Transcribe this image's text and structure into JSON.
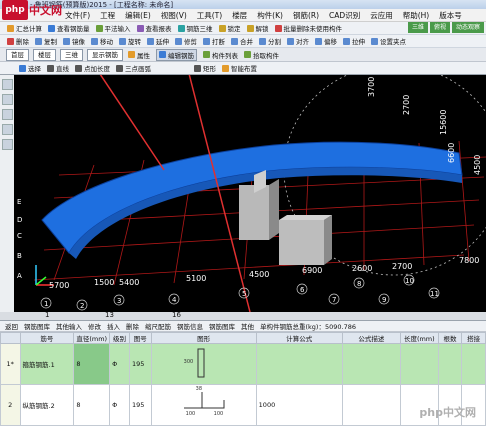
{
  "logo": {
    "badge": "php",
    "text": "中文网"
  },
  "title_bar": {
    "text": "- 鲁班钢筋(预算版)2015 - [工程名称: 未命名]"
  },
  "menu": [
    "文件(F)",
    "工程",
    "编辑(E)",
    "视图(V)",
    "工具(T)",
    "楼层",
    "构件(K)",
    "钢筋(R)",
    "CAD识别",
    "云应用",
    "帮助(H)",
    "版本号"
  ],
  "toolbar1": [
    "汇总计算",
    "查看钢筋量",
    "平法输入",
    "查看报表",
    "钢筋三维",
    "锁定",
    "解锁",
    "批量删除未使用构件",
    "动态观察"
  ],
  "toolbar2": [
    "删除",
    "复制",
    "镜像",
    "移动",
    "旋转",
    "延伸",
    "修剪",
    "打断",
    "合并",
    "分割",
    "对齐",
    "偏移",
    "拉伸",
    "设置夹点"
  ],
  "toolbar3": {
    "floor_select": "首层",
    "category_select": "楼层",
    "item_select": "三维",
    "layer_select": "显示钢筋",
    "buttons": [
      "属性",
      "编辑钢筋",
      "构件列表",
      "拾取构件"
    ]
  },
  "toolbar4": {
    "select_label": "选择",
    "buttons": [
      "直线",
      "点加长度",
      "三点画弧",
      "矩形",
      "智能布置"
    ]
  },
  "right_buttons": [
    "三维",
    "俯视",
    "动态观察"
  ],
  "viewport": {
    "dims_top": [
      "3700",
      "2700",
      "15600",
      "6600",
      "4500"
    ],
    "dims_bottom": [
      "5700",
      "1500",
      "5400",
      "5100",
      "4500",
      "6900",
      "2600",
      "2700",
      "7800"
    ],
    "axis_letters": [
      "E",
      "D",
      "C",
      "B",
      "A"
    ],
    "axis_numbers": [
      "1",
      "2",
      "3",
      "4",
      "5",
      "6",
      "7",
      "8",
      "9",
      "10",
      "11"
    ]
  },
  "ruler": {
    "marks": [
      "1",
      "13",
      "16"
    ]
  },
  "grid_toolbar": [
    "返回",
    "钢筋图库",
    "其他输入",
    "修改",
    "插入",
    "删除",
    "缩尺配筋",
    "钢筋信息",
    "钢筋图库",
    "其他",
    "单构件钢筋总重(kg)：5090.786"
  ],
  "grid": {
    "headers": [
      "",
      "筋号",
      "直径(mm)",
      "级别",
      "图号",
      "图形",
      "计算公式",
      "公式描述",
      "长度(mm)",
      "根数",
      "搭接"
    ],
    "rows": [
      {
        "num": "1*",
        "name": "箍筋钢筋.1",
        "dia": "8",
        "grade": "Φ",
        "fig": "195",
        "calc": "",
        "len": "",
        "count": ""
      },
      {
        "num": "2",
        "name": "纵筋钢筋.2",
        "dia": "8",
        "grade": "Φ",
        "fig": "195",
        "calc": "1000",
        "len": "",
        "count": ""
      }
    ],
    "fig_labels": [
      "300",
      "38",
      "100",
      "100"
    ]
  },
  "watermark": "php中文网"
}
